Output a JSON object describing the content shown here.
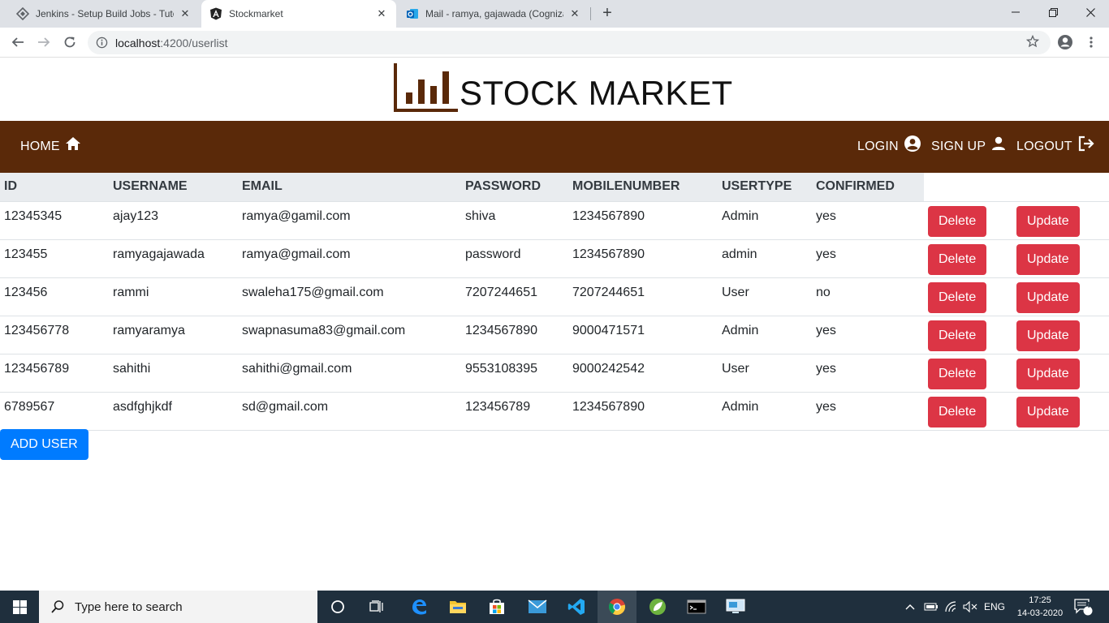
{
  "browser": {
    "tabs": [
      {
        "label": "Jenkins - Setup Build Jobs - Tutor",
        "active": false
      },
      {
        "label": "Stockmarket",
        "active": true
      },
      {
        "label": "Mail - ramya, gajawada (Cognizant",
        "active": false
      }
    ],
    "url_host": "localhost",
    "url_path": ":4200/userlist"
  },
  "brand": {
    "title": "STOCK MARKET"
  },
  "navbar": {
    "home": "HOME",
    "login": "LOGIN",
    "signup": "SIGN UP",
    "logout": "LOGOUT"
  },
  "table": {
    "headers": [
      "ID",
      "USERNAME",
      "EMAIL",
      "PASSWORD",
      "MOBILENUMBER",
      "USERTYPE",
      "CONFIRMED"
    ],
    "delete_label": "Delete",
    "update_label": "Update",
    "rows": [
      {
        "id": "12345345",
        "username": "ajay123",
        "email": "ramya@gamil.com",
        "password": "shiva",
        "mobile": "1234567890",
        "usertype": "Admin",
        "confirmed": "yes"
      },
      {
        "id": "123455",
        "username": "ramyagajawada",
        "email": "ramya@gmail.com",
        "password": "password",
        "mobile": "1234567890",
        "usertype": "admin",
        "confirmed": "yes"
      },
      {
        "id": "123456",
        "username": "rammi",
        "email": "swaleha175@gmail.com",
        "password": "7207244651",
        "mobile": "7207244651",
        "usertype": "User",
        "confirmed": "no"
      },
      {
        "id": "123456778",
        "username": "ramyaramya",
        "email": "swapnasuma83@gmail.com",
        "password": "1234567890",
        "mobile": "9000471571",
        "usertype": "Admin",
        "confirmed": "yes"
      },
      {
        "id": "123456789",
        "username": "sahithi",
        "email": "sahithi@gmail.com",
        "password": "9553108395",
        "mobile": "9000242542",
        "usertype": "User",
        "confirmed": "yes"
      },
      {
        "id": "6789567",
        "username": "asdfghjkdf",
        "email": "sd@gmail.com",
        "password": "123456789",
        "mobile": "1234567890",
        "usertype": "Admin",
        "confirmed": "yes"
      }
    ]
  },
  "add_user_label": "ADD USER",
  "taskbar": {
    "search_placeholder": "Type here to search",
    "language": "ENG",
    "time": "17:25",
    "date": "14-03-2020",
    "notifications": "4"
  },
  "colors": {
    "navbar": "#5a2909",
    "danger": "#dc3545",
    "primary": "#007bff"
  }
}
